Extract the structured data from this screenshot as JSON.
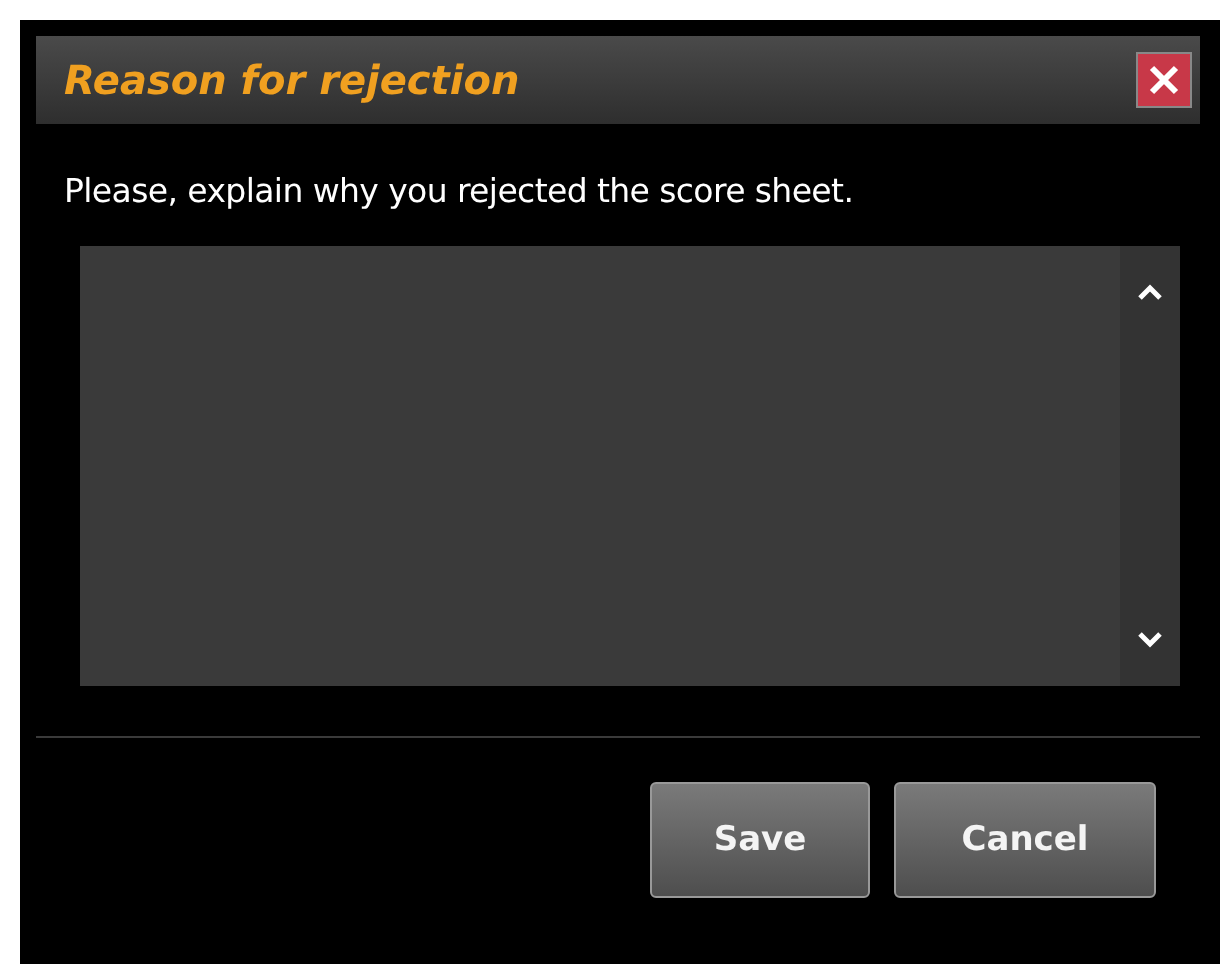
{
  "dialog": {
    "title": "Reason for rejection",
    "message": "Please, explain why you rejected the score sheet.",
    "buttons": [
      "Save",
      "Cancel"
    ]
  }
}
